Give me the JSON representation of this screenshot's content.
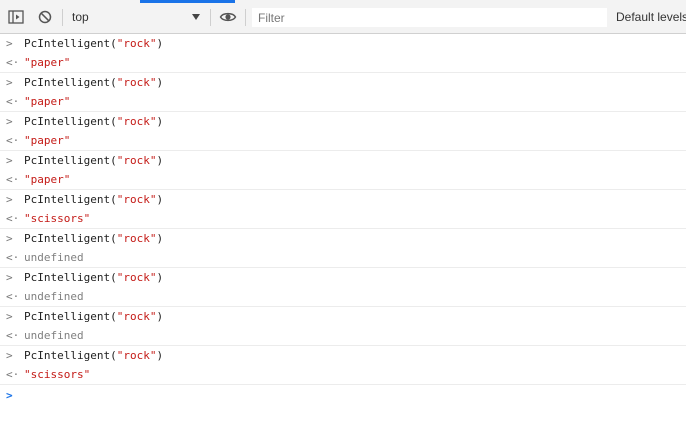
{
  "toolbar": {
    "context": "top",
    "filter_placeholder": "Filter",
    "levels": "Default levels",
    "icons": [
      "sidebar-toggle-icon",
      "clear-console-icon",
      "eye-icon",
      "chevron-down-icon"
    ]
  },
  "console": {
    "input_prompt": ">",
    "output_prompt": "<·",
    "entries": [
      {
        "fn": "PcIntelligent(",
        "arg": "\"rock\"",
        "close": ")",
        "result": "\"paper\"",
        "result_type": "string"
      },
      {
        "fn": "PcIntelligent(",
        "arg": "\"rock\"",
        "close": ")",
        "result": "\"paper\"",
        "result_type": "string"
      },
      {
        "fn": "PcIntelligent(",
        "arg": "\"rock\"",
        "close": ")",
        "result": "\"paper\"",
        "result_type": "string"
      },
      {
        "fn": "PcIntelligent(",
        "arg": "\"rock\"",
        "close": ")",
        "result": "\"paper\"",
        "result_type": "string"
      },
      {
        "fn": "PcIntelligent(",
        "arg": "\"rock\"",
        "close": ")",
        "result": "\"scissors\"",
        "result_type": "string"
      },
      {
        "fn": "PcIntelligent(",
        "arg": "\"rock\"",
        "close": ")",
        "result": "undefined",
        "result_type": "undefined"
      },
      {
        "fn": "PcIntelligent(",
        "arg": "\"rock\"",
        "close": ")",
        "result": "undefined",
        "result_type": "undefined"
      },
      {
        "fn": "PcIntelligent(",
        "arg": "\"rock\"",
        "close": ")",
        "result": "undefined",
        "result_type": "undefined"
      },
      {
        "fn": "PcIntelligent(",
        "arg": "\"rock\"",
        "close": ")",
        "result": "\"scissors\"",
        "result_type": "string"
      }
    ]
  },
  "colors": {
    "string": "#c41a16",
    "undefined": "#808080",
    "accent": "#1a73e8"
  }
}
